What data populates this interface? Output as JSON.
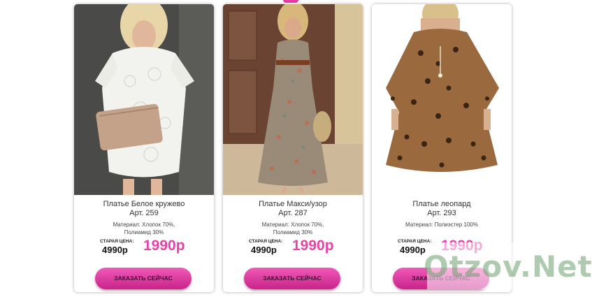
{
  "products": [
    {
      "title": "Платье Белое кружево",
      "article": "Арт. 259",
      "material_line1": "Материал: Хлопок 70%,",
      "material_line2": "Полиамид 30%",
      "old_price_label": "СТАРАЯ ЦЕНА:",
      "old_price": "4990р",
      "new_price": "1990р",
      "button_label": "ЗАКАЗАТЬ СЕЙЧАС"
    },
    {
      "title": "Платье Макси/узор",
      "article": "Арт. 287",
      "material_line1": "Материал: Хлопок 70%,",
      "material_line2": "Полиамид 30%",
      "old_price_label": "СТАРАЯ ЦЕНА:",
      "old_price": "4990р",
      "new_price": "1990р",
      "button_label": "ЗАКАЗАТЬ СЕЙЧАС"
    },
    {
      "title": "Платье леопард",
      "article": "Арт. 293",
      "material_line1": "Материал: Полиэстер 100%",
      "material_line2": "",
      "old_price_label": "СТАРАЯ ЦЕНА:",
      "old_price": "4990р",
      "new_price": "1990р",
      "button_label": "ЗАКАЗАТЬ СЕЙЧАС"
    }
  ],
  "watermark": "Otzov.Net",
  "colors": {
    "accent": "#e642a8",
    "button_top": "#f05ab7",
    "button_bottom": "#c8238a"
  }
}
